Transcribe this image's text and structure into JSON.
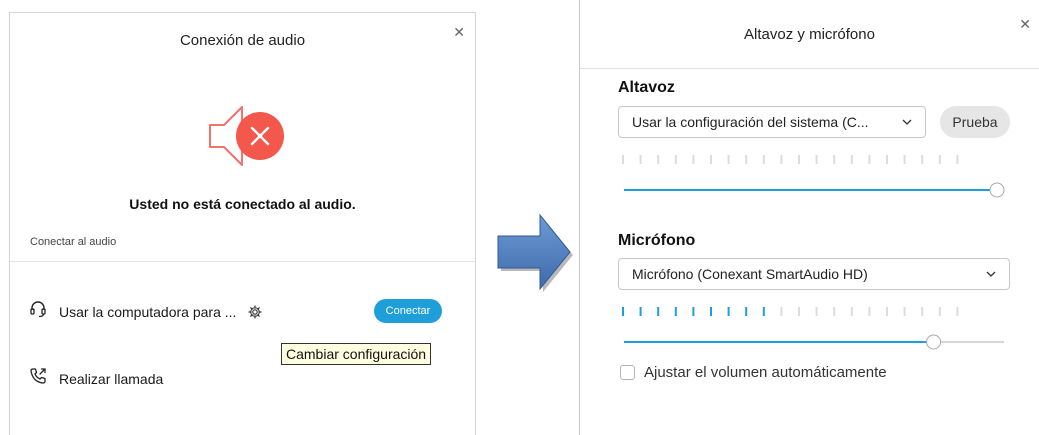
{
  "left_dialog": {
    "title": "Conexión de audio",
    "status_text": "Usted no está conectado al audio.",
    "section_label": "Conectar al audio",
    "computer_option_label": "Usar la computadora para ...",
    "connect_button": "Conectar",
    "tooltip": "Cambiar configuración",
    "call_option_label": "Realizar llamada"
  },
  "right_dialog": {
    "title": "Altavoz y micrófono",
    "speaker": {
      "heading": "Altavoz",
      "selected": "Usar la configuración del sistema (C...",
      "test_button": "Prueba",
      "level_active_ticks": 0,
      "volume": 1.0
    },
    "microphone": {
      "heading": "Micrófono",
      "selected": "Micrófono (Conexant SmartAudio HD)",
      "level_active_ticks": 9,
      "volume": 0.83
    },
    "auto_adjust_label": "Ajustar el volumen automáticamente",
    "auto_adjust_checked": false
  },
  "colors": {
    "accent": "#1e9fd9",
    "error": "#f4574b",
    "speaker_outline": "#f4716a",
    "tooltip_bg": "#ffffe1",
    "arrow": "#4f7fc1"
  },
  "icons": {
    "speaker_muted": "speaker-muted-icon",
    "headset": "headset-icon",
    "gear": "gear-icon",
    "phone": "phone-outgoing-icon",
    "close": "close-icon",
    "chevron": "chevron-down-icon"
  }
}
